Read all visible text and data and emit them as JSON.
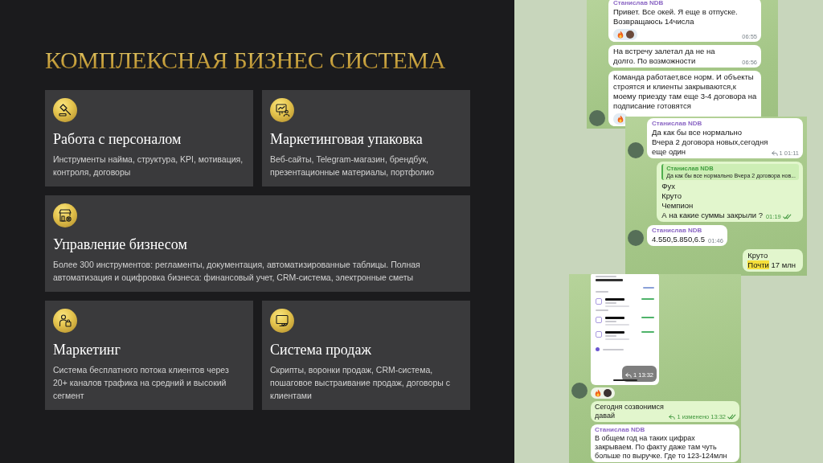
{
  "title": "КОМПЛЕКСНАЯ БИЗНЕС СИСТЕМА",
  "cards": [
    {
      "title": "Работа с персоналом",
      "text": "Инструменты найма, структура, KPI, мотивация, контроля, договоры"
    },
    {
      "title": "Маркетинговая упаковка",
      "text": "Веб-сайты, Telegram-магазин, брендбук, презентационные материалы, портфолио"
    },
    {
      "title": "Управление бизнесом",
      "text": "Более 300 инструментов: регламенты, документация, автоматизированные таблицы. Полная автоматизация и оцифровка бизнеса: финансовый учет, CRM-система, электронные сметы"
    },
    {
      "title": "Маркетинг",
      "text": "Система бесплатного потока клиентов через 20+ каналов трафика на средний и высокий сегмент"
    },
    {
      "title": "Система продаж",
      "text": "Скрипты, воронки продаж, CRM-система, пошаговое выстраивание продаж, договоры с клиентами"
    }
  ],
  "chat_screenshots": [
    {
      "messages": [
        {
          "kind": "incoming",
          "avatar": false,
          "read": false,
          "sender": "Станислав NDB",
          "lines": [
            {
              "text": "Привет. Все окей. Я еще в отпуске. Возвращаюсь 14числа"
            }
          ],
          "reactions": [
            {
              "kind": "emoji"
            },
            {
              "kind": "avatar"
            }
          ],
          "time": "06:55"
        },
        {
          "kind": "incoming",
          "avatar": false,
          "read": false,
          "lines": [
            {
              "text": "На встречу залетал да не на долго. По возможности"
            }
          ],
          "time": "06:56"
        },
        {
          "kind": "incoming",
          "avatar": true,
          "read": false,
          "lines": [
            {
              "text": "Команда работает,все норм. И объекты строятся и клиенты закрываются,к моему приезду там еще 3-4 договора на подписание готовятся"
            }
          ],
          "reactions": [
            {
              "kind": "emoji"
            }
          ]
        }
      ]
    },
    {
      "messages": [
        {
          "kind": "incoming",
          "avatar": true,
          "read": false,
          "sender": "Станислав NDB",
          "lines": [
            {
              "text": "Да как бы все нормально"
            },
            {
              "text": "Вчера 2 договора новых,сегодня еще один"
            }
          ],
          "replies": "1",
          "time": "01:11"
        },
        {
          "kind": "outgoing",
          "avatar": false,
          "read": true,
          "reply": {
            "sender": "Станислав NDB",
            "text": "Да как бы все нормально Вчера 2 договора нов..."
          },
          "lines": [
            {
              "text": "Фух"
            },
            {
              "text": "Круто"
            },
            {
              "text": "Чемпион"
            },
            {
              "text": "А на какие суммы закрыли ?"
            }
          ],
          "time": "01:19"
        },
        {
          "kind": "incoming",
          "avatar": true,
          "read": false,
          "sender": "Станислав NDB",
          "lines": [
            {
              "text": "4.550,5.850,6.5"
            }
          ],
          "time": "01:46"
        },
        {
          "kind": "outgoing",
          "avatar": false,
          "read": false,
          "lines": [
            {
              "text": "Круто"
            },
            {
              "mark": "Почти",
              "text": "17 млн"
            }
          ]
        }
      ]
    },
    {
      "messages": [
        {
          "kind": "image",
          "avatar": true,
          "read": false,
          "replies": "1",
          "time": "13:32",
          "reactions": [
            {
              "kind": "emoji"
            },
            {
              "kind": "avatar"
            }
          ]
        },
        {
          "kind": "outgoing",
          "avatar": false,
          "read": true,
          "lines": [
            {
              "text": "Сегодня созвонимся давай"
            }
          ],
          "replies": "1",
          "edited": "изменено",
          "time": "13:32"
        },
        {
          "kind": "incoming",
          "avatar": false,
          "read": false,
          "sender": "Станислав NDB",
          "lines": [
            {
              "text": "В общем год на таких цифрах закрываем. По факту даже там чуть больше по выручке. Где то 123-124млн"
            }
          ]
        }
      ]
    }
  ]
}
